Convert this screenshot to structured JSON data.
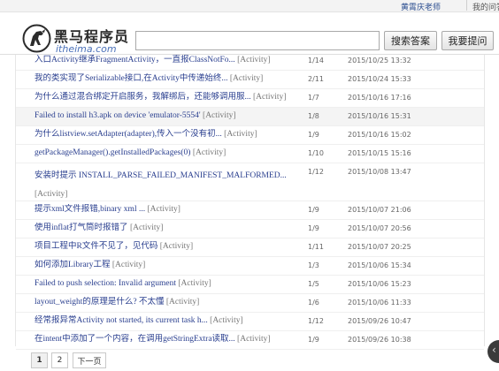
{
  "topbar": {
    "user": "黄霄庆老师",
    "my_questions": "我的问答"
  },
  "logo": {
    "name_cn": "黑马程序员",
    "name_en": "itheima.com"
  },
  "search": {
    "placeholder": "",
    "value": "",
    "search_button": "搜索答案",
    "ask_button": "我要提问"
  },
  "questions": [
    {
      "title": "入口Activity继承FragmentActivity，一直报ClassNotFo...",
      "category": "[Activity]",
      "count": "1/14",
      "date": "2015/10/25 13:32"
    },
    {
      "title": "我的类实现了Serializable接口,在Activity中传递始终...",
      "category": "[Activity]",
      "count": "2/11",
      "date": "2015/10/24 15:33"
    },
    {
      "title": "为什么通过混合绑定开启服务，我解绑后，还能够调用服...",
      "category": "[Activity]",
      "count": "1/7",
      "date": "2015/10/16 17:16"
    },
    {
      "title": "Failed to install h3.apk on device 'emulator-5554'",
      "category": "[Activity]",
      "count": "1/8",
      "date": "2015/10/16 15:31"
    },
    {
      "title": "为什么listview.setAdapter(adapter),传入一个没有初...",
      "category": "[Activity]",
      "count": "1/9",
      "date": "2015/10/16 15:02"
    },
    {
      "title": "getPackageManager().getInstalledPackages(0)",
      "category": "[Activity]",
      "count": "1/10",
      "date": "2015/10/15 15:16"
    },
    {
      "title": "安装时提示 INSTALL_PARSE_FAILED_MANIFEST_MALFORMED...",
      "category": "[Activity]",
      "count": "1/12",
      "date": "2015/10/08 13:47"
    },
    {
      "title": "提示xml文件报错,binary xml ...",
      "category": "[Activity]",
      "count": "1/9",
      "date": "2015/10/07 21:06"
    },
    {
      "title": "使用inflat打气筒时报错了",
      "category": "[Activity]",
      "count": "1/9",
      "date": "2015/10/07 20:56"
    },
    {
      "title": "项目工程中R文件不见了，见代码",
      "category": "[Activity]",
      "count": "1/11",
      "date": "2015/10/07 20:25"
    },
    {
      "title": "如何添加Library工程",
      "category": "[Activity]",
      "count": "1/3",
      "date": "2015/10/06 15:34"
    },
    {
      "title": "Failed to push selection: Invalid argument",
      "category": "[Activity]",
      "count": "1/5",
      "date": "2015/10/06 15:23"
    },
    {
      "title": "layout_weight的原理是什么? 不太懂",
      "category": "[Activity]",
      "count": "1/6",
      "date": "2015/10/06 11:33"
    },
    {
      "title": "经常报异常Activity not started, its current task h...",
      "category": "[Activity]",
      "count": "1/12",
      "date": "2015/09/26 10:47"
    },
    {
      "title": "在intent中添加了一个内容，在调用getStringExtra读取...",
      "category": "[Activity]",
      "count": "1/9",
      "date": "2015/09/26 10:38"
    }
  ],
  "pagination": {
    "page1": "1",
    "page2": "2",
    "next": "下一页"
  }
}
